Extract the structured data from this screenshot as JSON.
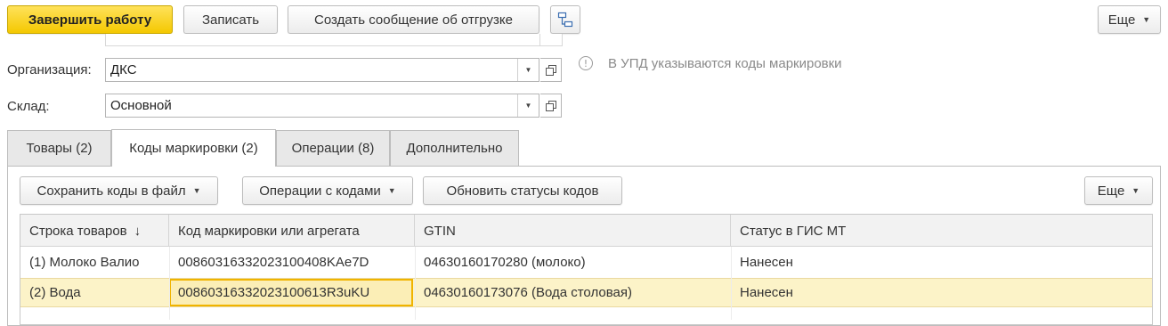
{
  "toolbar": {
    "finish_label": "Завершить работу",
    "save_label": "Записать",
    "create_shipment_label": "Создать сообщение об отгрузке",
    "more_label": "Еще"
  },
  "form": {
    "org_label": "Организация:",
    "org_value": "ДКС",
    "warehouse_label": "Склад:",
    "warehouse_value": "Основной",
    "info_text": "В УПД указываются коды маркировки"
  },
  "tabs": [
    {
      "label": "Товары (2)",
      "active": false
    },
    {
      "label": "Коды маркировки (2)",
      "active": true
    },
    {
      "label": "Операции (8)",
      "active": false
    },
    {
      "label": "Дополнительно",
      "active": false
    }
  ],
  "panel_toolbar": {
    "save_codes_label": "Сохранить коды в файл",
    "code_ops_label": "Операции с кодами",
    "refresh_status_label": "Обновить статусы кодов",
    "more_label": "Еще"
  },
  "table": {
    "columns": [
      "Строка товаров",
      "Код маркировки или агрегата",
      "GTIN",
      "Статус в ГИС МТ"
    ],
    "sort_indicator": "↓",
    "rows": [
      {
        "line": "(1) Молоко Валио",
        "code": "0086031633202310040 8KAe7D",
        "gtin": "04630160170280 (молоко)",
        "status": "Нанесен",
        "selected": false
      },
      {
        "line": "(2) Вода",
        "code": "008603163320231006 13R3uKU",
        "gtin": "04630160173076 (Вода столовая)",
        "status": "Нанесен",
        "selected": true
      }
    ]
  },
  "colors": {
    "primary_button": "#f4c800",
    "selected_row": "#fcf3c8",
    "selected_cell_border": "#f0b400",
    "header_bg": "#f2f2f2",
    "tab_bg": "#e8e8e8"
  }
}
